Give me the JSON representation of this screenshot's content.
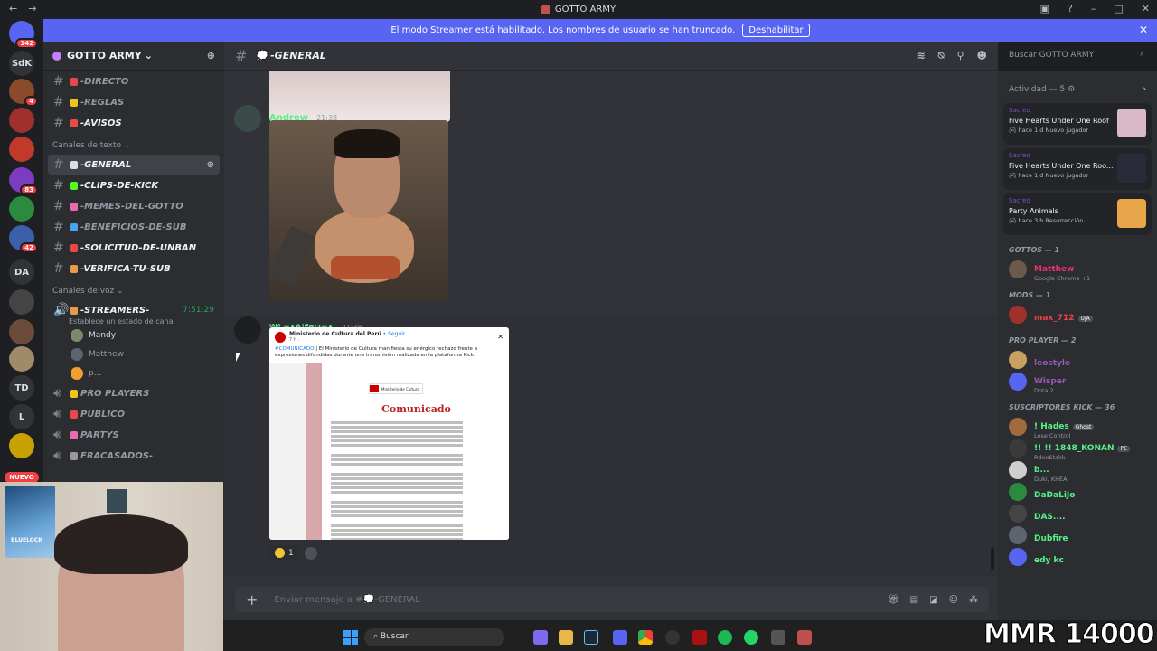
{
  "window": {
    "title": "GOTTO ARMY",
    "back_glyph": "←",
    "forward_glyph": "→"
  },
  "banner": {
    "text": "El modo Streamer está habilitado. Los nombres de usuario se han truncado.",
    "button": "Deshabilitar"
  },
  "servers": [
    {
      "label": "",
      "badge": "142",
      "color": "#5865f2"
    },
    {
      "label": "SdK",
      "badge": "",
      "color": "#313338"
    },
    {
      "label": "",
      "badge": "4",
      "color": "#8a4b2c"
    },
    {
      "label": "",
      "badge": "",
      "color": "#a0302c"
    },
    {
      "label": "",
      "badge": "",
      "color": "#c0392b"
    },
    {
      "label": "",
      "badge": "83",
      "color": "#7d3cc0"
    },
    {
      "label": "",
      "badge": "",
      "color": "#2b8a3e"
    },
    {
      "label": "",
      "badge": "42",
      "color": "#3b5fa8"
    },
    {
      "label": "DA",
      "badge": "",
      "color": "#313338"
    },
    {
      "label": "",
      "badge": "",
      "color": "#444"
    },
    {
      "label": "",
      "badge": "",
      "color": "#6b4b3a"
    },
    {
      "label": "",
      "badge": "",
      "color": "#a08a6a"
    },
    {
      "label": "TD",
      "badge": "",
      "color": "#313338"
    },
    {
      "label": "L",
      "badge": "",
      "color": "#313338"
    },
    {
      "label": "",
      "badge": "",
      "color": "#c8a200"
    }
  ],
  "new_badge": "NUEVO",
  "guild": {
    "name": "GOTTO ARMY",
    "chevron": "⌄"
  },
  "channels_top": [
    {
      "name": "-DIRECTO",
      "emoji_color": "#e84a4a"
    },
    {
      "name": "-REGLAS",
      "emoji_color": "#f0c419"
    },
    {
      "name": "-AVISOS",
      "emoji_color": "#e84a4a",
      "white": true
    }
  ],
  "text_category": "Canales de texto",
  "text_channels": [
    {
      "name": "-GENERAL",
      "emoji_color": "#dbdee1",
      "active": true
    },
    {
      "name": "-CLIPS-DE-KICK",
      "emoji_color": "#53fc18",
      "white": true
    },
    {
      "name": "-MEMES-DEL-GOTTO",
      "emoji_color": "#e86ab0"
    },
    {
      "name": "-BENEFICIOS-DE-SUB",
      "emoji_color": "#4aa3e8"
    },
    {
      "name": "-SOLICITUD-DE-UNBAN",
      "emoji_color": "#e84a4a",
      "white": true
    },
    {
      "name": "-VERIFICA-TU-SUB",
      "emoji_color": "#e89a4a",
      "white": true
    }
  ],
  "voice_category": "Canales de voz",
  "streamers": {
    "name": "-STREAMERS-",
    "timer": "7:51:29",
    "status": "Establece un estado de canal"
  },
  "voice_users": [
    {
      "name": "Mandy",
      "dim": false
    },
    {
      "name": "Matthew",
      "dim": true
    },
    {
      "name": "p...",
      "dim": true
    }
  ],
  "voice_channels": [
    "PRO PLAYERS",
    "PUBLICO",
    "PARTYS",
    "FRACASADOS-"
  ],
  "header": {
    "channel": "-GENERAL",
    "search_placeholder": "Buscar GOTTO ARMY"
  },
  "messages": [
    {
      "author": "Andrew",
      "time": "21:38",
      "color": "#57f287"
    },
    {
      "author": "ᴵᴬᴹ ≈•Δ|ƭαω≈•",
      "time": "21:38",
      "color": "#57f287"
    }
  ],
  "embed": {
    "source": "Ministerio de Cultura del Perú",
    "follow": "• Seguir",
    "age": "7 h ·",
    "hashtag": "#COMUNICADO",
    "text": " | El Ministerio de Cultura manifiesta su enérgico rechazo frente a expresiones difundidas durante una transmisión realizada en la plataforma Kick.",
    "doc_title": "Comunicado",
    "logo_text": "Ministerio de Cultura"
  },
  "reaction": {
    "count": "1"
  },
  "composer": {
    "placeholder": "Enviar mensaje a #💭-GENERAL"
  },
  "activity": {
    "title": "Actividad — 5",
    "items": [
      {
        "who": "Sacred",
        "game": "Five Hearts Under One Roof",
        "time": "hace 1 d",
        "tag": "Nuevo jugador",
        "thumb": "#d9b8c8"
      },
      {
        "who": "Sacred",
        "game": "Five Hearts Under One Roo...",
        "time": "hace 1 d",
        "tag": "Nuevo jugador",
        "thumb": "#2b2a3a"
      },
      {
        "who": "Sacred",
        "game": "Party Animals",
        "time": "hace 3 h",
        "tag": "Resurrección",
        "thumb": "#e9a54a"
      }
    ]
  },
  "roles": [
    {
      "title": "GOTTOS — 1",
      "members": [
        {
          "name": "Matthew",
          "color": "#e8336e",
          "sub": "Google Chrome +1"
        }
      ]
    },
    {
      "title": "MODS — 1",
      "members": [
        {
          "name": "max_712",
          "color": "#ed4245",
          "sub": "",
          "tag": "UJA"
        }
      ]
    },
    {
      "title": "PRO PLAYER — 2",
      "members": [
        {
          "name": "leostyle",
          "color": "#9b59b6",
          "sub": ""
        },
        {
          "name": "Wisper",
          "color": "#9b59b6",
          "sub": "Dota 2"
        }
      ]
    },
    {
      "title": "SUSCRIPTORES KICK — 36",
      "members": [
        {
          "name": "! Hades",
          "color": "#57f287",
          "sub": "Lose Control",
          "tag": "Ghost"
        },
        {
          "name": "!! !! 1848_KONAN",
          "color": "#57f287",
          "sub": "RdxxStakk",
          "tag": "PE"
        },
        {
          "name": "b...",
          "color": "#57f287",
          "sub": "Duki, KHEA"
        },
        {
          "name": "DaDaLiJo",
          "color": "#57f287",
          "sub": ""
        },
        {
          "name": "DAS....",
          "color": "#57f287",
          "sub": ""
        },
        {
          "name": "Dubfire",
          "color": "#57f287",
          "sub": ""
        },
        {
          "name": "edy kc",
          "color": "#57f287",
          "sub": ""
        }
      ]
    }
  ],
  "webcam": {
    "poster_text": "BLUELOCK"
  },
  "taskbar": {
    "search": "Buscar"
  },
  "overlay": {
    "mmr": "MMR 14000"
  }
}
